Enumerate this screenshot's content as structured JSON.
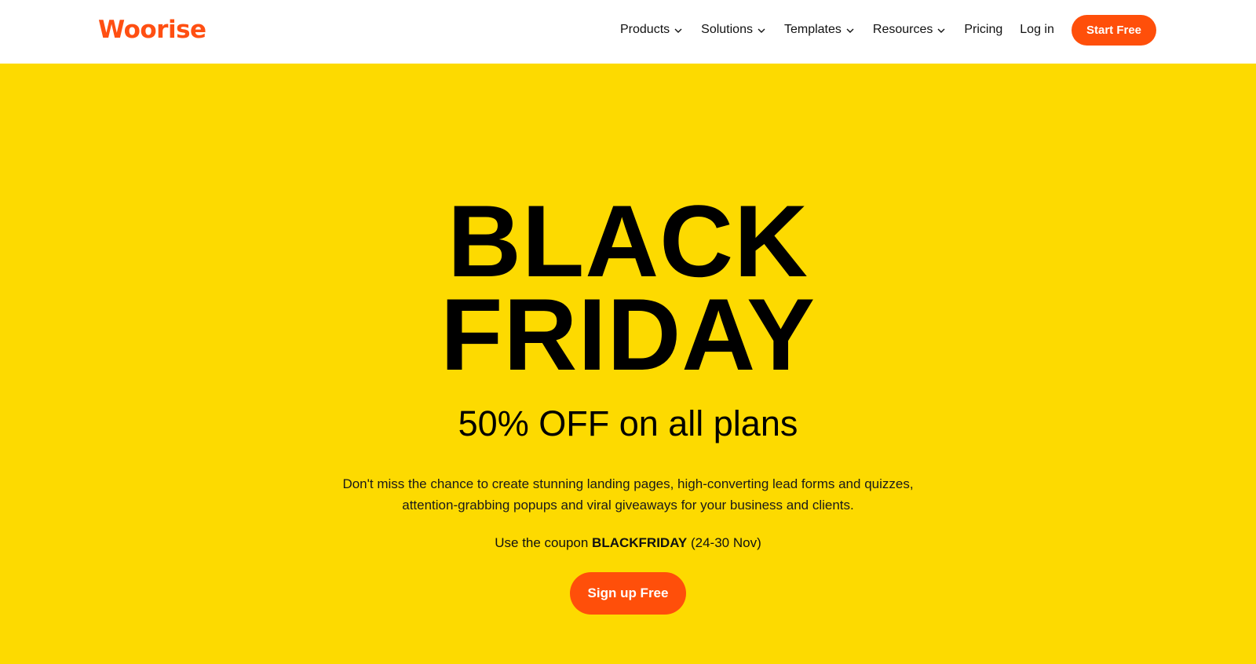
{
  "brand": {
    "logo_text": "Woorise",
    "accent_color": "#ff4f0a",
    "hero_bg_color": "#fdda00"
  },
  "nav": {
    "items": [
      {
        "label": "Products",
        "has_dropdown": true,
        "icon": "chevron-down-icon"
      },
      {
        "label": "Solutions",
        "has_dropdown": true,
        "icon": "chevron-down-icon"
      },
      {
        "label": "Templates",
        "has_dropdown": true,
        "icon": "chevron-down-icon"
      },
      {
        "label": "Resources",
        "has_dropdown": true,
        "icon": "chevron-down-icon"
      }
    ],
    "pricing_label": "Pricing",
    "login_label": "Log in",
    "cta_label": "Start Free"
  },
  "hero": {
    "headline_line1": "BLACK",
    "headline_line2": "FRIDAY",
    "subheadline": "50% OFF on all plans",
    "description_line1": "Don't miss the chance to create stunning landing pages, high-converting lead forms and quizzes,",
    "description_line2": "attention-grabbing popups and viral giveaways for your business and clients.",
    "coupon_prefix": "Use the coupon ",
    "coupon_code": "BLACKFRIDAY",
    "coupon_suffix": " (24-30 Nov)",
    "cta_label": "Sign up Free"
  }
}
